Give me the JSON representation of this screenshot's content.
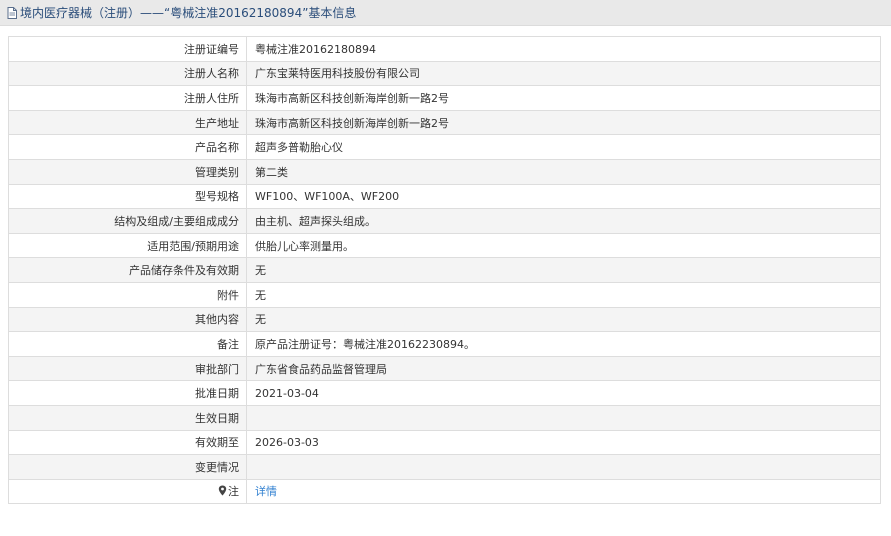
{
  "header": {
    "icon": "document-icon",
    "title": "境内医疗器械（注册）——“粤械注准20162180894”基本信息"
  },
  "rows": [
    {
      "label": "注册证编号",
      "value": "粤械注准20162180894"
    },
    {
      "label": "注册人名称",
      "value": "广东宝莱特医用科技股份有限公司"
    },
    {
      "label": "注册人住所",
      "value": "珠海市高新区科技创新海岸创新一路2号"
    },
    {
      "label": "生产地址",
      "value": "珠海市高新区科技创新海岸创新一路2号"
    },
    {
      "label": "产品名称",
      "value": "超声多普勒胎心仪"
    },
    {
      "label": "管理类别",
      "value": "第二类"
    },
    {
      "label": "型号规格",
      "value": "WF100、WF100A、WF200"
    },
    {
      "label": "结构及组成/主要组成成分",
      "value": "由主机、超声探头组成。"
    },
    {
      "label": "适用范围/预期用途",
      "value": "供胎儿心率测量用。"
    },
    {
      "label": "产品储存条件及有效期",
      "value": "无"
    },
    {
      "label": "附件",
      "value": "无"
    },
    {
      "label": "其他内容",
      "value": "无"
    },
    {
      "label": "备注",
      "value": "原产品注册证号：粤械注准20162230894。"
    },
    {
      "label": "审批部门",
      "value": "广东省食品药品监督管理局"
    },
    {
      "label": "批准日期",
      "value": "2021-03-04"
    },
    {
      "label": "生效日期",
      "value": ""
    },
    {
      "label": "有效期至",
      "value": "2026-03-03"
    },
    {
      "label": "变更情况",
      "value": ""
    }
  ],
  "note_row": {
    "icon": "pin-icon",
    "label": "注",
    "link_text": "详情"
  },
  "colors": {
    "header_bg": "#e9e9e9",
    "title_color": "#2a4d7a",
    "link_color": "#2f7fd0",
    "border": "#dddddd",
    "stripe": "#f4f4f4"
  }
}
